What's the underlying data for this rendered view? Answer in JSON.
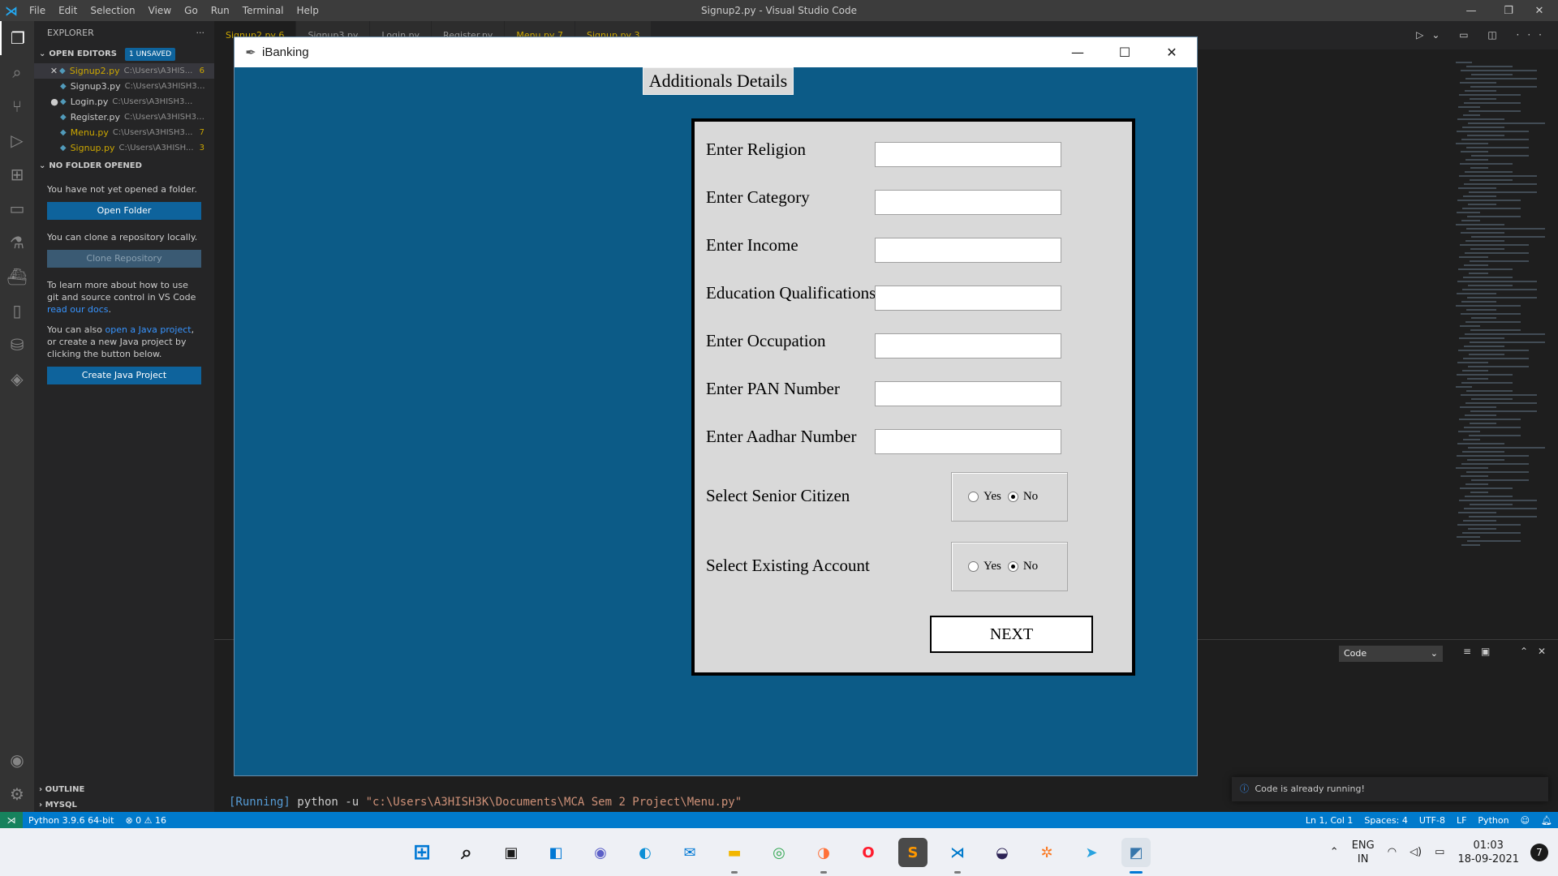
{
  "vscode": {
    "menu": [
      "File",
      "Edit",
      "Selection",
      "View",
      "Go",
      "Run",
      "Terminal",
      "Help"
    ],
    "window_title": "Signup2.py - Visual Studio Code",
    "explorer": {
      "header": "EXPLORER",
      "open_editors": "OPEN EDITORS",
      "unsaved_badge": "1 UNSAVED",
      "files": [
        {
          "name": "Signup2.py",
          "path": "C:\\Users\\A3HIS...",
          "count": "6"
        },
        {
          "name": "Signup3.py",
          "path": "C:\\Users\\A3HISH3K\\D...",
          "count": ""
        },
        {
          "name": "Login.py",
          "path": "C:\\Users\\A3HISH3K\\Doc...",
          "count": ""
        },
        {
          "name": "Register.py",
          "path": "C:\\Users\\A3HISH3K\\D...",
          "count": ""
        },
        {
          "name": "Menu.py",
          "path": "C:\\Users\\A3HISH3...",
          "count": "7"
        },
        {
          "name": "Signup.py",
          "path": "C:\\Users\\A3HISH...",
          "count": "3"
        }
      ],
      "no_folder": "NO FOLDER OPENED",
      "no_folder_text": "You have not yet opened a folder.",
      "open_folder": "Open Folder",
      "clone_text": "You can clone a repository locally.",
      "clone_repo": "Clone Repository",
      "learn_text": "To learn more about how to use git and source control in VS Code",
      "learn_link": "read our docs",
      "java_text_1": "You can also",
      "java_link": "open a Java project",
      "java_text_2": ", or create a new Java project by clicking the button below.",
      "create_java": "Create Java Project",
      "outline": "OUTLINE",
      "mysql": "MYSQL"
    },
    "tabs": [
      {
        "label": "Signup2.py 6"
      },
      {
        "label": "Signup3.py"
      },
      {
        "label": "Login.py"
      },
      {
        "label": "Register.py"
      },
      {
        "label": "Menu.py 7"
      },
      {
        "label": "Signup.py 3"
      }
    ],
    "output_select": "Code",
    "run_tag": "[Running]",
    "run_cmd": " python -u ",
    "run_path": "\"c:\\Users\\A3HISH3K\\Documents\\MCA Sem 2 Project\\Menu.py\"",
    "toast": "Code is already running!",
    "status": {
      "python": "Python 3.9.6 64-bit",
      "problems": "⊗ 0 ⚠ 16",
      "position": "Ln 1, Col 1",
      "spaces": "Spaces: 4",
      "encoding": "UTF-8",
      "eol": "LF",
      "language": "Python"
    }
  },
  "taskbar": {
    "lang_1": "ENG",
    "lang_2": "IN",
    "time": "01:03",
    "date": "18-09-2021",
    "notifications": "7"
  },
  "app": {
    "title": "iBanking",
    "heading": "Additionals Details",
    "fields": [
      {
        "label": "Enter Religion",
        "value": ""
      },
      {
        "label": "Enter Category",
        "value": ""
      },
      {
        "label": "Enter Income",
        "value": ""
      },
      {
        "label": "Education Qualifications",
        "value": ""
      },
      {
        "label": "Enter Occupation",
        "value": ""
      },
      {
        "label": "Enter PAN Number",
        "value": ""
      },
      {
        "label": "Enter Aadhar Number",
        "value": ""
      }
    ],
    "senior_citizen": {
      "label": "Select Senior Citizen",
      "yes": "Yes",
      "no": "No",
      "selected": "No"
    },
    "existing_account": {
      "label": "Select Existing Account",
      "yes": "Yes",
      "no": "No",
      "selected": "No"
    },
    "next_button": "NEXT"
  },
  "colors": {
    "app_background": "#0c5b87",
    "form_background": "#d9d9d9",
    "vscode_accent": "#007acc"
  }
}
